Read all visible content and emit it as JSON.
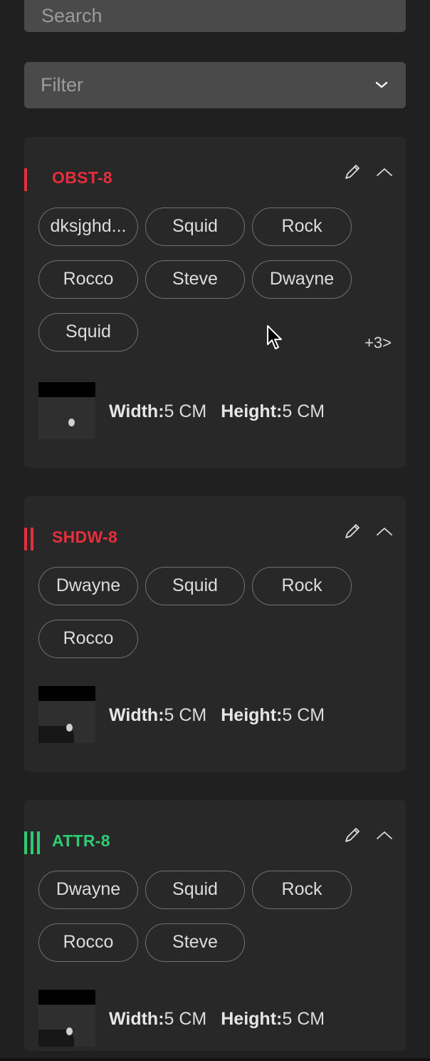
{
  "search": {
    "placeholder": "Search"
  },
  "filter": {
    "label": "Filter"
  },
  "units_label": "5 CM",
  "width_label": "Width:",
  "height_label": "Height:",
  "colors": {
    "red": "#e62e3c",
    "green": "#2ecc71"
  },
  "cards": [
    {
      "title": "OBST-8",
      "accent": "#e62e3c",
      "bar_count": 1,
      "tags": [
        "dksjghd...",
        "Squid",
        "Rock",
        "Rocco",
        "Steve",
        "Dwayne",
        "Squid"
      ],
      "more": "+3>",
      "width": "5 CM",
      "height": "5 CM"
    },
    {
      "title": "SHDW-8",
      "accent": "#e62e3c",
      "bar_count": 2,
      "tags": [
        "Dwayne",
        "Squid",
        "Rock",
        "Rocco"
      ],
      "width": "5 CM",
      "height": "5 CM"
    },
    {
      "title": "ATTR-8",
      "accent": "#2ecc71",
      "bar_count": 3,
      "tags": [
        "Dwayne",
        "Squid",
        "Rock",
        "Rocco",
        "Steve"
      ],
      "width": "5 CM",
      "height": "5 CM"
    }
  ]
}
